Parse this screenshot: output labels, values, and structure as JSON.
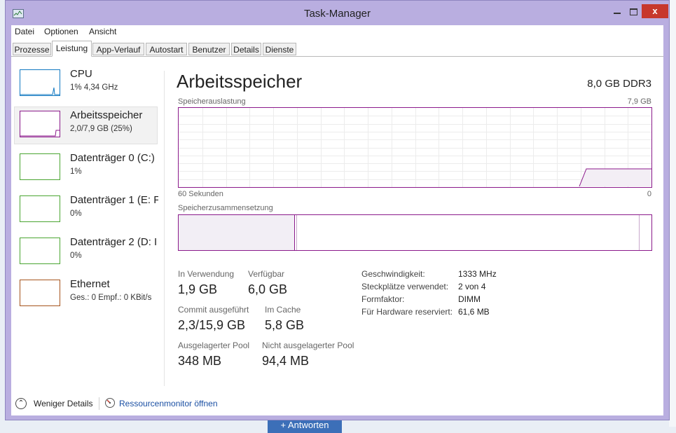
{
  "window": {
    "title": "Task-Manager",
    "close_glyph": "x"
  },
  "menu": [
    "Datei",
    "Optionen",
    "Ansicht"
  ],
  "tabs": [
    {
      "label": "Prozesse",
      "active": false
    },
    {
      "label": "Leistung",
      "active": true
    },
    {
      "label": "App-Verlauf",
      "active": false
    },
    {
      "label": "Autostart",
      "active": false
    },
    {
      "label": "Benutzer",
      "active": false
    },
    {
      "label": "Details",
      "active": false
    },
    {
      "label": "Dienste",
      "active": false
    }
  ],
  "sidebar": [
    {
      "title": "CPU",
      "subtitle": "1% 4,34 GHz",
      "color": "#1279c2"
    },
    {
      "title": "Arbeitsspeicher",
      "subtitle": "2,0/7,9 GB (25%)",
      "color": "#8b1a8b"
    },
    {
      "title": "Datenträger 0 (C:)",
      "subtitle": "1%",
      "color": "#4aa531"
    },
    {
      "title": "Datenträger 1 (E: F",
      "subtitle": "0%",
      "color": "#4aa531"
    },
    {
      "title": "Datenträger 2 (D: I",
      "subtitle": "0%",
      "color": "#4aa531"
    },
    {
      "title": "Ethernet",
      "subtitle": "Ges.: 0 Empf.: 0 KBit/s",
      "color": "#a5541c"
    }
  ],
  "main": {
    "title": "Arbeitsspeicher",
    "spec": "8,0 GB DDR3",
    "graph_label": "Speicherauslastung",
    "graph_max": "7,9 GB",
    "graph_time": "60 Sekunden",
    "graph_zero": "0",
    "composition_label": "Speicherzusammensetzung",
    "stats": {
      "in_use_label": "In Verwendung",
      "in_use": "1,9 GB",
      "available_label": "Verfügbar",
      "available": "6,0 GB",
      "commit_label": "Commit ausgeführt",
      "commit": "2,3/15,9 GB",
      "cached_label": "Im Cache",
      "cached": "5,8 GB",
      "paged_label": "Ausgelagerter Pool",
      "paged": "348 MB",
      "nonpaged_label": "Nicht ausgelagerter Pool",
      "nonpaged": "94,4 MB"
    },
    "properties": [
      {
        "key": "Geschwindigkeit:",
        "value": "1333 MHz"
      },
      {
        "key": "Steckplätze verwendet:",
        "value": "2 von 4"
      },
      {
        "key": "Formfaktor:",
        "value": "DIMM"
      },
      {
        "key": "Für Hardware reserviert:",
        "value": "61,6 MB"
      }
    ]
  },
  "footer": {
    "less_details": "Weniger Details",
    "resource_monitor": "Ressourcenmonitor öffnen"
  },
  "background": {
    "button": "+ Antworten"
  }
}
